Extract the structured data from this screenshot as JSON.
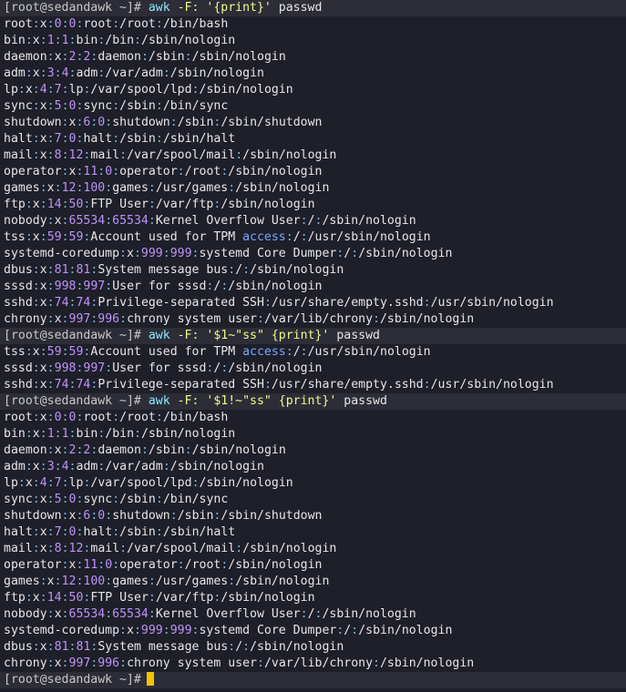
{
  "colors": {
    "background": "#1e1f29",
    "prompt_bar": "#2c2d37",
    "text": "#e6e6e6",
    "command": "#8be9fd",
    "string": "#f1fa8c",
    "separator": "#7fb3d5",
    "number": "#bd93f9",
    "keyword": "#7aa6ff",
    "cursor": "#f5c400"
  },
  "prompt": "[root@sedandawk ~]#",
  "lines": [
    {
      "type": "prompt",
      "cmd": "awk",
      "flag": "-F:",
      "prog": "'{print}'",
      "file": "passwd"
    },
    {
      "type": "out",
      "text": "root:x:0:0:root:/root:/bin/bash"
    },
    {
      "type": "out",
      "text": "bin:x:1:1:bin:/bin:/sbin/nologin"
    },
    {
      "type": "out",
      "text": "daemon:x:2:2:daemon:/sbin:/sbin/nologin"
    },
    {
      "type": "out",
      "text": "adm:x:3:4:adm:/var/adm:/sbin/nologin"
    },
    {
      "type": "out",
      "text": "lp:x:4:7:lp:/var/spool/lpd:/sbin/nologin"
    },
    {
      "type": "out",
      "text": "sync:x:5:0:sync:/sbin:/bin/sync"
    },
    {
      "type": "out",
      "text": "shutdown:x:6:0:shutdown:/sbin:/sbin/shutdown"
    },
    {
      "type": "out",
      "text": "halt:x:7:0:halt:/sbin:/sbin/halt"
    },
    {
      "type": "out",
      "text": "mail:x:8:12:mail:/var/spool/mail:/sbin/nologin"
    },
    {
      "type": "out",
      "text": "operator:x:11:0:operator:/root:/sbin/nologin"
    },
    {
      "type": "out",
      "text": "games:x:12:100:games:/usr/games:/sbin/nologin"
    },
    {
      "type": "out",
      "text": "ftp:x:14:50:FTP User:/var/ftp:/sbin/nologin"
    },
    {
      "type": "out",
      "text": "nobody:x:65534:65534:Kernel Overflow User:/:/sbin/nologin"
    },
    {
      "type": "out",
      "text": "tss:x:59:59:Account used for TPM access:/:/usr/sbin/nologin"
    },
    {
      "type": "out",
      "text": "systemd-coredump:x:999:999:systemd Core Dumper:/:/sbin/nologin"
    },
    {
      "type": "out",
      "text": "dbus:x:81:81:System message bus:/:/sbin/nologin"
    },
    {
      "type": "out",
      "text": "sssd:x:998:997:User for sssd:/:/sbin/nologin"
    },
    {
      "type": "out",
      "text": "sshd:x:74:74:Privilege-separated SSH:/usr/share/empty.sshd:/usr/sbin/nologin"
    },
    {
      "type": "out",
      "text": "chrony:x:997:996:chrony system user:/var/lib/chrony:/sbin/nologin"
    },
    {
      "type": "prompt",
      "cmd": "awk",
      "flag": "-F:",
      "prog": "'$1~\"ss\" {print}'",
      "file": "passwd"
    },
    {
      "type": "out",
      "text": "tss:x:59:59:Account used for TPM access:/:/usr/sbin/nologin"
    },
    {
      "type": "out",
      "text": "sssd:x:998:997:User for sssd:/:/sbin/nologin"
    },
    {
      "type": "out",
      "text": "sshd:x:74:74:Privilege-separated SSH:/usr/share/empty.sshd:/usr/sbin/nologin"
    },
    {
      "type": "prompt",
      "cmd": "awk",
      "flag": "-F:",
      "prog": "'$1!~\"ss\" {print}'",
      "file": "passwd"
    },
    {
      "type": "out",
      "text": "root:x:0:0:root:/root:/bin/bash"
    },
    {
      "type": "out",
      "text": "bin:x:1:1:bin:/bin:/sbin/nologin"
    },
    {
      "type": "out",
      "text": "daemon:x:2:2:daemon:/sbin:/sbin/nologin"
    },
    {
      "type": "out",
      "text": "adm:x:3:4:adm:/var/adm:/sbin/nologin"
    },
    {
      "type": "out",
      "text": "lp:x:4:7:lp:/var/spool/lpd:/sbin/nologin"
    },
    {
      "type": "out",
      "text": "sync:x:5:0:sync:/sbin:/bin/sync"
    },
    {
      "type": "out",
      "text": "shutdown:x:6:0:shutdown:/sbin:/sbin/shutdown"
    },
    {
      "type": "out",
      "text": "halt:x:7:0:halt:/sbin:/sbin/halt"
    },
    {
      "type": "out",
      "text": "mail:x:8:12:mail:/var/spool/mail:/sbin/nologin"
    },
    {
      "type": "out",
      "text": "operator:x:11:0:operator:/root:/sbin/nologin"
    },
    {
      "type": "out",
      "text": "games:x:12:100:games:/usr/games:/sbin/nologin"
    },
    {
      "type": "out",
      "text": "ftp:x:14:50:FTP User:/var/ftp:/sbin/nologin"
    },
    {
      "type": "out",
      "text": "nobody:x:65534:65534:Kernel Overflow User:/:/sbin/nologin"
    },
    {
      "type": "out",
      "text": "systemd-coredump:x:999:999:systemd Core Dumper:/:/sbin/nologin"
    },
    {
      "type": "out",
      "text": "dbus:x:81:81:System message bus:/:/sbin/nologin"
    },
    {
      "type": "out",
      "text": "chrony:x:997:996:chrony system user:/var/lib/chrony:/sbin/nologin"
    },
    {
      "type": "input",
      "cmd": "",
      "flag": "",
      "prog": "",
      "file": ""
    }
  ]
}
